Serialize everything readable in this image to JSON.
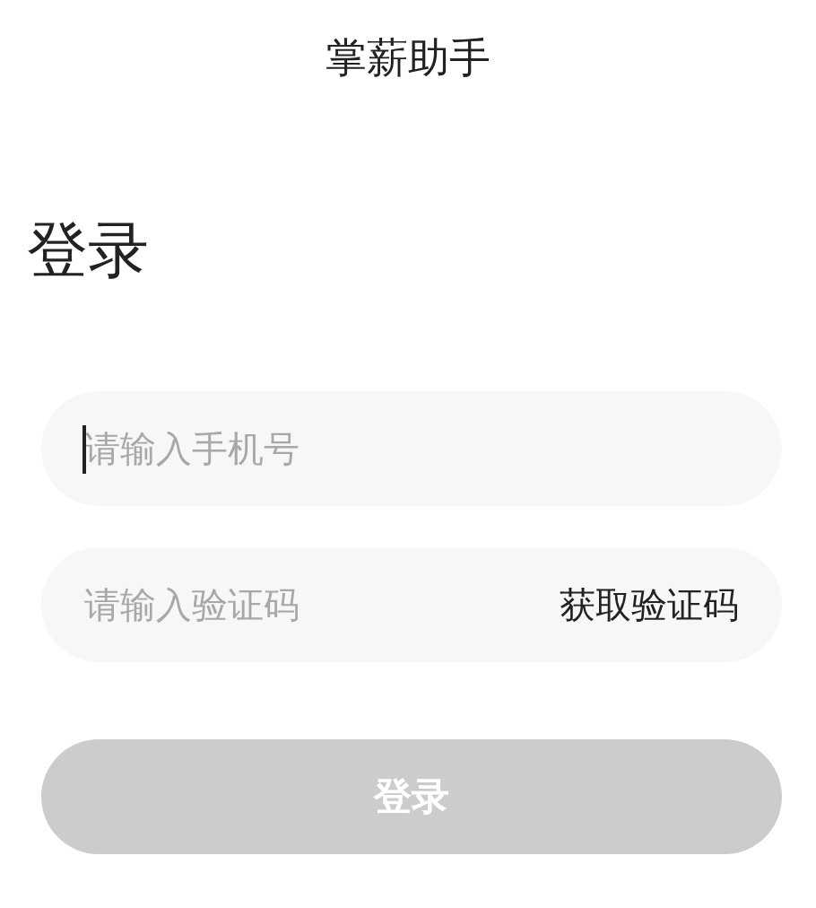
{
  "header": {
    "title": "掌薪助手"
  },
  "heading": "登录",
  "phone_field": {
    "placeholder": "请输入手机号",
    "focused": true
  },
  "code_field": {
    "placeholder": "请输入验证码",
    "action": "获取验证码"
  },
  "login_button": {
    "label": "登录",
    "disabled": true
  }
}
